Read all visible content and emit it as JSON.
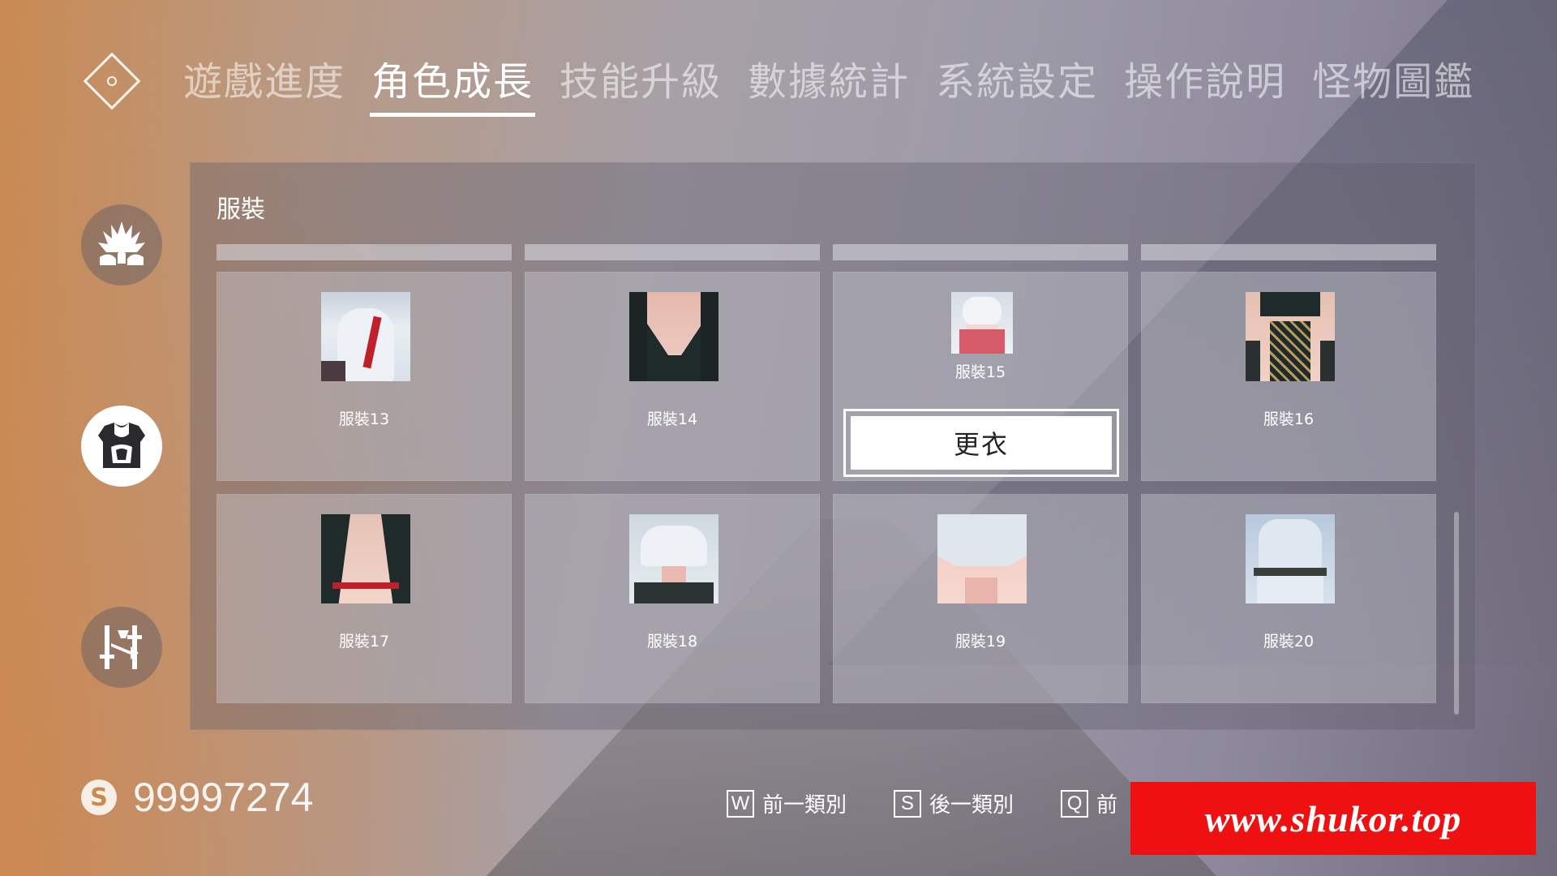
{
  "nav": {
    "tabs": [
      {
        "label": "遊戲進度"
      },
      {
        "label": "角色成長"
      },
      {
        "label": "技能升級"
      },
      {
        "label": "數據統計"
      },
      {
        "label": "系統設定"
      },
      {
        "label": "操作說明"
      },
      {
        "label": "怪物圖鑑"
      }
    ],
    "active_tab": "角色成長"
  },
  "sidebar": {
    "icons": [
      {
        "name": "fire-lotus-icon",
        "active": false
      },
      {
        "name": "costume-icon",
        "active": true
      },
      {
        "name": "weapons-icon",
        "active": false
      }
    ]
  },
  "panel": {
    "title": "服裝",
    "costumes": [
      {
        "label": "服裝13",
        "thumb": "costume-13-image"
      },
      {
        "label": "服裝14",
        "thumb": "costume-14-image"
      },
      {
        "label": "服裝15",
        "thumb": "costume-15-image",
        "selected": true
      },
      {
        "label": "服裝16",
        "thumb": "costume-16-image"
      },
      {
        "label": "服裝17",
        "thumb": "costume-17-image"
      },
      {
        "label": "服裝18",
        "thumb": "costume-18-image"
      },
      {
        "label": "服裝19",
        "thumb": "costume-19-image"
      },
      {
        "label": "服裝20",
        "thumb": "costume-20-image"
      }
    ],
    "equip_button": "更衣"
  },
  "footer": {
    "currency_symbol": "S",
    "money": "99997274",
    "hints": [
      {
        "key": "W",
        "label": "前一類別"
      },
      {
        "key": "S",
        "label": "後一類別"
      },
      {
        "key": "Q",
        "label": "前"
      }
    ]
  },
  "watermark": "www.shukor.top",
  "colors": {
    "watermark_bg": "#ef1111",
    "accent": "#ffffff"
  }
}
